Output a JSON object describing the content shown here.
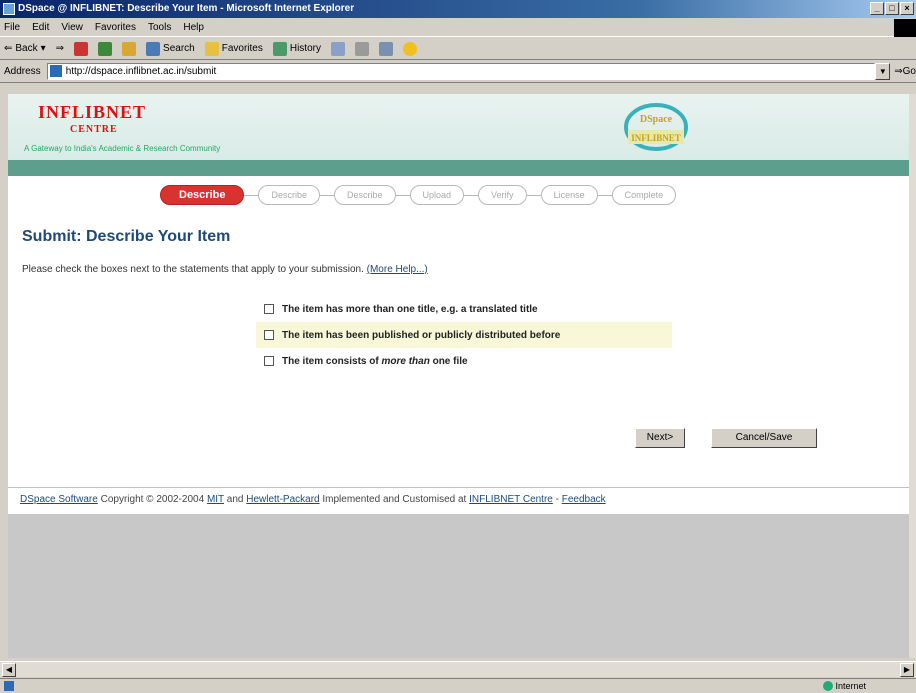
{
  "window": {
    "title": "DSpace @ INFLIBNET: Describe Your Item - Microsoft Internet Explorer",
    "buttons": [
      "_",
      "□",
      "×"
    ]
  },
  "menu": [
    "File",
    "Edit",
    "View",
    "Favorites",
    "Tools",
    "Help"
  ],
  "toolbar": {
    "back": "Back",
    "search": "Search",
    "favorites": "Favorites",
    "history": "History"
  },
  "address": {
    "label": "Address",
    "url": "http://dspace.inflibnet.ac.in/submit",
    "go": "Go"
  },
  "header": {
    "logo_text": "INFLIBNET",
    "logo_sub": "CENTRE",
    "tagline": "A Gateway to India's Academic & Research Community",
    "dspace_logo": "DSpace @ INFLIBNET"
  },
  "steps": [
    "Describe",
    "Describe",
    "Describe",
    "Upload",
    "Verify",
    "License",
    "Complete"
  ],
  "page": {
    "title": "Submit: Describe Your Item",
    "instructions": "Please check the boxes next to the statements that apply to your submission.",
    "more_help": "(More Help...)",
    "options": [
      {
        "before": "The item has more than one title, e.g. a translated title",
        "em": "",
        "after": "",
        "checked": false
      },
      {
        "before": "The item has been published or publicly distributed before",
        "em": "",
        "after": "",
        "checked": false
      },
      {
        "before": "The item consists of ",
        "em": "more than",
        "after": " one file",
        "checked": false
      }
    ],
    "next_button": "Next>",
    "cancel_button": "Cancel/Save"
  },
  "footer": {
    "dspace_link": "DSpace Software",
    "copyright": " Copyright © 2002-2004 ",
    "mit_link": "MIT",
    "and": " and ",
    "hp_link": "Hewlett-Packard",
    "implemented": " Implemented and Customised at ",
    "inflibnet_link": "INFLIBNET Centre",
    "sep": " - ",
    "feedback_link": "Feedback"
  },
  "status": {
    "zone": "Internet"
  },
  "colors": {
    "accent_red": "#d9332f",
    "title_blue": "#1f4a78",
    "header_green": "#5e9e8c"
  }
}
